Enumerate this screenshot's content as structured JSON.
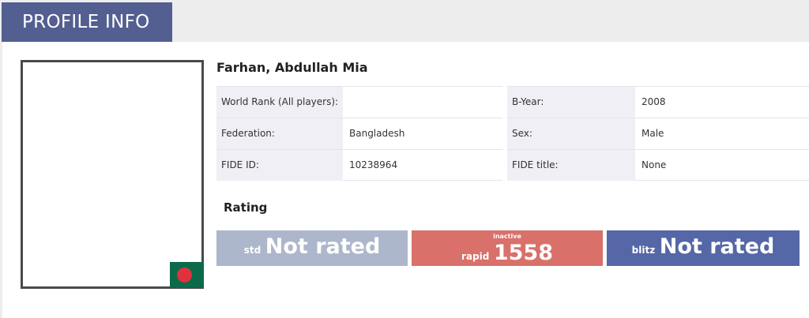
{
  "tab": {
    "label": "PROFILE INFO"
  },
  "player": {
    "name": "Farhan, Abdullah Mia"
  },
  "info": {
    "world_rank_label": "World Rank (All players):",
    "world_rank_value": "",
    "federation_label": "Federation:",
    "federation_value": "Bangladesh",
    "fide_id_label": "FIDE ID:",
    "fide_id_value": "10238964",
    "byear_label": "B-Year:",
    "byear_value": "2008",
    "sex_label": "Sex:",
    "sex_value": "Male",
    "fide_title_label": "FIDE title:",
    "fide_title_value": "None"
  },
  "rating": {
    "title": "Rating",
    "std": {
      "label": "std",
      "value": "Not rated"
    },
    "rapid": {
      "status": "inactive",
      "label": "rapid",
      "value": "1558"
    },
    "blitz": {
      "label": "blitz",
      "value": "Not rated"
    }
  },
  "colors": {
    "accent": "#535f91",
    "std": "#adb7cb",
    "rapid": "#d9706a",
    "blitz": "#5567a6",
    "flag_green": "#0b6a4a",
    "flag_red": "#e0313d"
  },
  "icons": {
    "flag": "bangladesh-flag-icon"
  }
}
